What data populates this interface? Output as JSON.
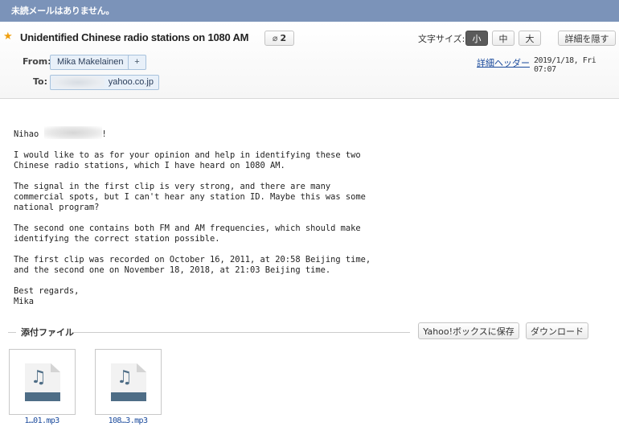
{
  "banner": {
    "text": "未読メールはありません。"
  },
  "header": {
    "subject": "Unidentified Chinese radio stations on 1080 AM",
    "attachment_count": "2",
    "font_size_label": "文字サイズ:",
    "font_sizes": [
      "小",
      "中",
      "大"
    ],
    "font_size_selected": "小",
    "hide_details_label": "詳細を隠す",
    "from_label": "From:",
    "from_name": "Mika Makelainen",
    "add_contact": "+",
    "to_label": "To:",
    "to_address": "yahoo.co.jp",
    "detail_header_link": "詳細ヘッダー",
    "date": "2019/1/18, Fri 07:07"
  },
  "body": {
    "greeting_start": "Nihao ",
    "greeting_end": "!",
    "paragraphs": [
      "I would like to as for your opinion and help in identifying these two\nChinese radio stations, which I have heard on 1080 AM.",
      "The signal in the first clip is very strong, and there are many\ncommercial spots, but I can't hear any station ID. Maybe this was some\nnational program?",
      "The second one contains both FM and AM frequencies, which should make\nidentifying the correct station possible.",
      "The first clip was recorded on October 16, 2011, at 20:58 Beijing time,\nand the second one on November 18, 2018, at 21:03 Beijing time.",
      "Best regards,\nMika"
    ]
  },
  "attachments": {
    "title": "添付ファイル",
    "save_button": "Yahoo!ボックスに保存",
    "download_button": "ダウンロード",
    "files": [
      {
        "name": "1…01.mp3",
        "icon": "audio-file-icon"
      },
      {
        "name": "108…3.mp3",
        "icon": "audio-file-icon"
      }
    ]
  },
  "colors": {
    "banner": "#7b93b9",
    "link": "#1a4a9c",
    "star": "#f0a010",
    "file_band": "#4e6d86"
  }
}
